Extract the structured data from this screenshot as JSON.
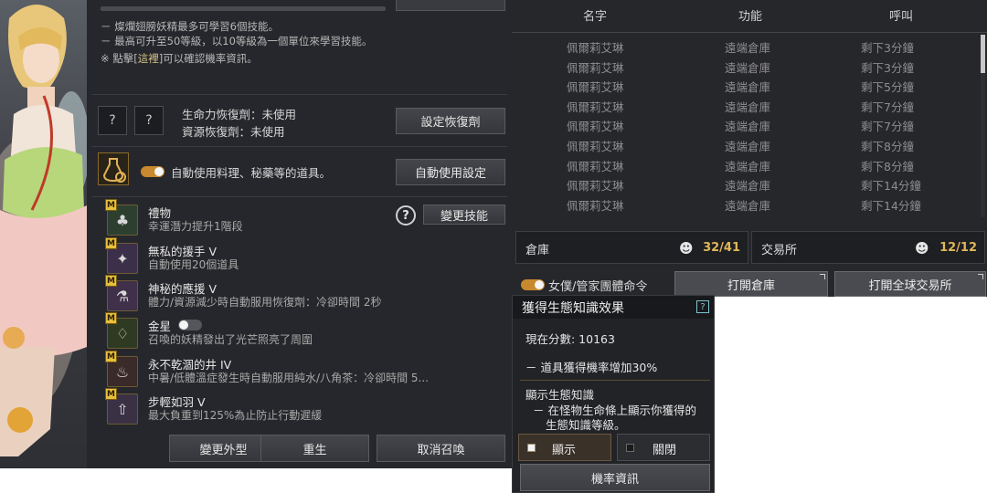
{
  "left_panel": {
    "notes": [
      "－ 燦爛翅膀妖精最多可學習6個技能。",
      "－ 最高可升至50等級，以10等級為一個單位來學習技能。"
    ],
    "info_prefix": "※ 點擊[",
    "info_link": "這裡",
    "info_suffix": "]可以確認機率資訊。",
    "slot1": "?",
    "slot2": "?",
    "hp_recovery": "生命力恢復劑：未使用",
    "resource_recovery": "資源恢復劑：未使用",
    "set_recovery_button": "設定恢復劑",
    "auto_use_text": "自動使用料理、秘藥等的道具。",
    "auto_use_button": "自動使用設定",
    "help_mark": "?",
    "change_skill_button": "變更技能",
    "skills": [
      {
        "badge": "M",
        "icon": "clover-icon",
        "name": "禮物",
        "desc": "幸運潛力提升1階段"
      },
      {
        "badge": "M",
        "icon": "fairy-hand-icon",
        "name": "無私的援手 V",
        "desc": "自動使用20個道具"
      },
      {
        "badge": "M",
        "icon": "potion-icon",
        "name": "神秘的應援 V",
        "desc": "體力/資源減少時自動服用恢復劑：冷卻時間 2秒"
      },
      {
        "badge": "M",
        "icon": "lantern-icon",
        "name": "金星",
        "desc": "召喚的妖精發出了光芒照亮了周圍"
      },
      {
        "badge": "M",
        "icon": "well-icon",
        "name": "永不乾涸的井 IV",
        "desc": "中暑/低體溫症發生時自動服用純水/八角茶：冷卻時間 5..."
      },
      {
        "badge": "M",
        "icon": "weight-icon",
        "name": "步輕如羽 V",
        "desc": "最大負重到125%為止防止行動遲緩"
      }
    ],
    "bottom_buttons": {
      "change_appearance": "變更外型",
      "rebirth": "重生",
      "cancel_summon": "取消召喚"
    }
  },
  "right_panel": {
    "headers": {
      "name": "名字",
      "function": "功能",
      "call": "呼叫"
    },
    "rows": [
      {
        "name": "佩爾莉艾琳",
        "function": "遠端倉庫",
        "call": "剩下3分鐘"
      },
      {
        "name": "佩爾莉艾琳",
        "function": "遠端倉庫",
        "call": "剩下3分鐘"
      },
      {
        "name": "佩爾莉艾琳",
        "function": "遠端倉庫",
        "call": "剩下5分鐘"
      },
      {
        "name": "佩爾莉艾琳",
        "function": "遠端倉庫",
        "call": "剩下7分鐘"
      },
      {
        "name": "佩爾莉艾琳",
        "function": "遠端倉庫",
        "call": "剩下7分鐘"
      },
      {
        "name": "佩爾莉艾琳",
        "function": "遠端倉庫",
        "call": "剩下8分鐘"
      },
      {
        "name": "佩爾莉艾琳",
        "function": "遠端倉庫",
        "call": "剩下8分鐘"
      },
      {
        "name": "佩爾莉艾琳",
        "function": "遠端倉庫",
        "call": "剩下14分鐘"
      },
      {
        "name": "佩爾莉艾琳",
        "function": "遠端倉庫",
        "call": "剩下14分鐘"
      }
    ],
    "warehouse": {
      "label": "倉庫",
      "count": "32/41"
    },
    "market": {
      "label": "交易所",
      "count": "12/12"
    },
    "maid_command": "女僕/管家團體命令",
    "open_warehouse_button": "打開倉庫",
    "open_market_button": "打開全球交易所"
  },
  "eco_popup": {
    "title": "獲得生態知識效果",
    "help": "?",
    "score": "現在分數: 10163",
    "bonus": "－ 道具獲得機率增加30%",
    "display_heading": "顯示生態知識",
    "display_desc_1": "－ 在怪物生命條上顯示你獲得的",
    "display_desc_2": "生態知識等級。",
    "show_option": "顯示",
    "hide_option": "關閉",
    "probability_button": "機率資訊"
  },
  "colors": {
    "panel_bg": "#26272c",
    "accent_gold": "#e1b657",
    "toggle_on": "#c8892e"
  }
}
